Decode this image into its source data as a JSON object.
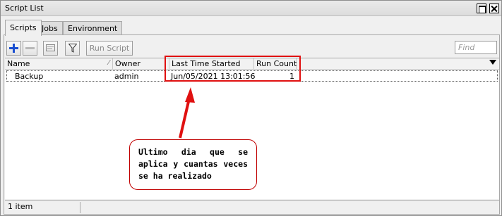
{
  "window": {
    "title": "Script List"
  },
  "tabs": [
    {
      "label": "Scripts",
      "active": true
    },
    {
      "label": "Jobs",
      "active": false
    },
    {
      "label": "Environment",
      "active": false
    }
  ],
  "toolbar": {
    "add_icon": "plus-icon",
    "remove_icon": "minus-icon",
    "comment_icon": "comment-icon",
    "filter_icon": "filter-icon",
    "run_label": "Run Script",
    "find_placeholder": "Find"
  },
  "table": {
    "columns": [
      "Name",
      "Owner",
      "Last Time Started",
      "Run Count"
    ],
    "rows": [
      {
        "name": "Backup",
        "owner": "admin",
        "last_started": "Jun/05/2021 13:01:56",
        "run_count": "1"
      }
    ]
  },
  "annotation": {
    "text": "Ultimo dia que se aplica y cuantas veces se ha realizado",
    "color": "#e01010"
  },
  "status": {
    "count_text": "1 item"
  },
  "colors": {
    "accent_blue": "#1a4fd1",
    "annotation_red": "#e01010"
  }
}
